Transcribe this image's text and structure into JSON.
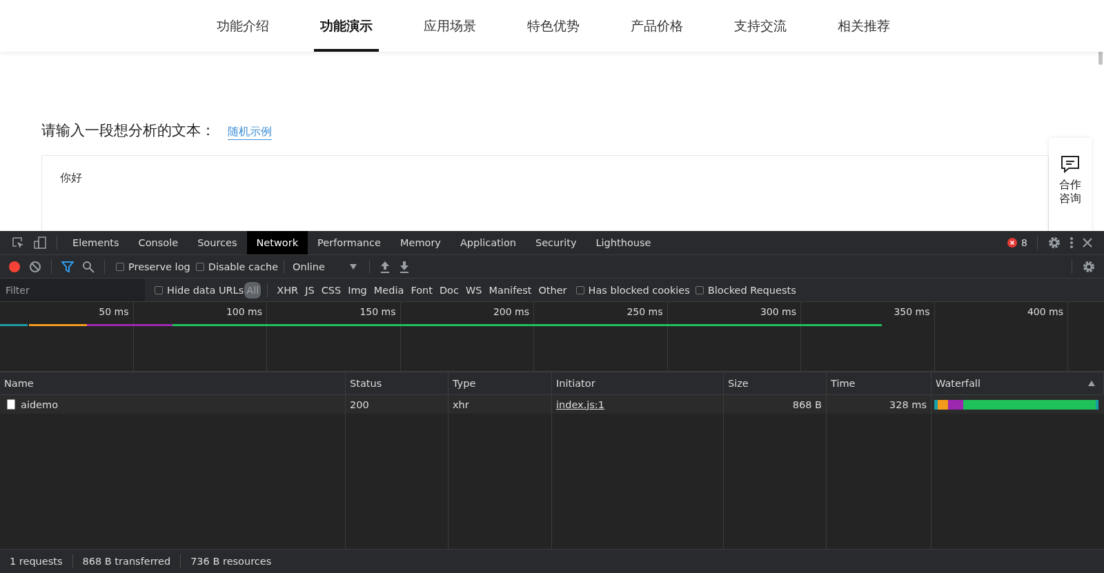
{
  "nav": {
    "items": [
      {
        "label": "功能介绍",
        "selected": false
      },
      {
        "label": "功能演示",
        "selected": true
      },
      {
        "label": "应用场景",
        "selected": false
      },
      {
        "label": "特色优势",
        "selected": false
      },
      {
        "label": "产品价格",
        "selected": false
      },
      {
        "label": "支持交流",
        "selected": false
      },
      {
        "label": "相关推荐",
        "selected": false
      }
    ]
  },
  "page": {
    "prompt": "请输入一段想分析的文本：",
    "example_link": "随机示例",
    "text_value": "你好",
    "consult_button": "合作咨询"
  },
  "devtools": {
    "tabs": [
      {
        "label": "Elements",
        "selected": false
      },
      {
        "label": "Console",
        "selected": false
      },
      {
        "label": "Sources",
        "selected": false
      },
      {
        "label": "Network",
        "selected": true
      },
      {
        "label": "Performance",
        "selected": false
      },
      {
        "label": "Memory",
        "selected": false
      },
      {
        "label": "Application",
        "selected": false
      },
      {
        "label": "Security",
        "selected": false
      },
      {
        "label": "Lighthouse",
        "selected": false
      }
    ],
    "error_count": "8",
    "toolbar": {
      "recording": true,
      "preserve_log": false,
      "disable_cache": false,
      "throttling": "Online"
    },
    "filter": {
      "placeholder": "Filter",
      "hide_data_urls": false,
      "types": [
        {
          "label": "All",
          "selected": true
        },
        {
          "label": "XHR",
          "selected": false
        },
        {
          "label": "JS",
          "selected": false
        },
        {
          "label": "CSS",
          "selected": false
        },
        {
          "label": "Img",
          "selected": false
        },
        {
          "label": "Media",
          "selected": false
        },
        {
          "label": "Font",
          "selected": false
        },
        {
          "label": "Doc",
          "selected": false
        },
        {
          "label": "WS",
          "selected": false
        },
        {
          "label": "Manifest",
          "selected": false
        },
        {
          "label": "Other",
          "selected": false
        }
      ],
      "has_blocked_cookies": false,
      "blocked_requests": false,
      "labels": {
        "hide_data_urls": "Hide data URLs",
        "has_blocked_cookies": "Has blocked cookies",
        "blocked_requests": "Blocked Requests",
        "preserve_log": "Preserve log",
        "disable_cache": "Disable cache"
      }
    },
    "overview_ticks": [
      "50 ms",
      "100 ms",
      "150 ms",
      "200 ms",
      "250 ms",
      "300 ms",
      "350 ms",
      "400 ms"
    ],
    "table": {
      "columns": [
        "Name",
        "Status",
        "Type",
        "Initiator",
        "Size",
        "Time",
        "Waterfall"
      ],
      "rows": [
        {
          "name": "aidemo",
          "status": "200",
          "type": "xhr",
          "initiator": "index.js:1",
          "size": "868 B",
          "time": "328 ms"
        }
      ]
    },
    "status_bar": [
      "1 requests",
      "868 B transferred",
      "736 B resources"
    ]
  }
}
